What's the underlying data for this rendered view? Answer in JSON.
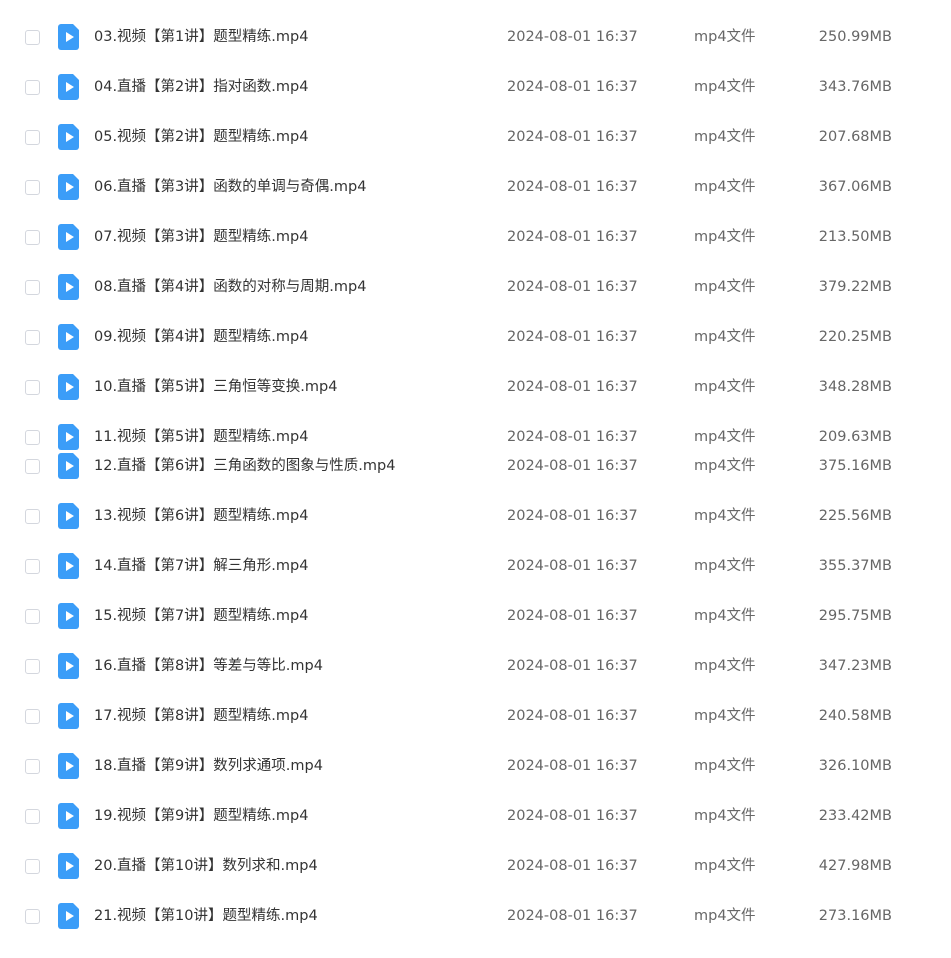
{
  "files": [
    {
      "name": "03.视频【第1讲】题型精练.mp4",
      "date": "2024-08-01 16:37",
      "type": "mp4文件",
      "size": "250.99MB"
    },
    {
      "name": "04.直播【第2讲】指对函数.mp4",
      "date": "2024-08-01 16:37",
      "type": "mp4文件",
      "size": "343.76MB"
    },
    {
      "name": "05.视频【第2讲】题型精练.mp4",
      "date": "2024-08-01 16:37",
      "type": "mp4文件",
      "size": "207.68MB"
    },
    {
      "name": "06.直播【第3讲】函数的单调与奇偶.mp4",
      "date": "2024-08-01 16:37",
      "type": "mp4文件",
      "size": "367.06MB"
    },
    {
      "name": "07.视频【第3讲】题型精练.mp4",
      "date": "2024-08-01 16:37",
      "type": "mp4文件",
      "size": "213.50MB"
    },
    {
      "name": "08.直播【第4讲】函数的对称与周期.mp4",
      "date": "2024-08-01 16:37",
      "type": "mp4文件",
      "size": "379.22MB"
    },
    {
      "name": "09.视频【第4讲】题型精练.mp4",
      "date": "2024-08-01 16:37",
      "type": "mp4文件",
      "size": "220.25MB"
    },
    {
      "name": "10.直播【第5讲】三角恒等变换.mp4",
      "date": "2024-08-01 16:37",
      "type": "mp4文件",
      "size": "348.28MB"
    },
    {
      "name": "11.视频【第5讲】题型精练.mp4",
      "date": "2024-08-01 16:37",
      "type": "mp4文件",
      "size": "209.63MB"
    },
    {
      "name": "12.直播【第6讲】三角函数的图象与性质.mp4",
      "date": "2024-08-01 16:37",
      "type": "mp4文件",
      "size": "375.16MB"
    },
    {
      "name": "13.视频【第6讲】题型精练.mp4",
      "date": "2024-08-01 16:37",
      "type": "mp4文件",
      "size": "225.56MB"
    },
    {
      "name": "14.直播【第7讲】解三角形.mp4",
      "date": "2024-08-01 16:37",
      "type": "mp4文件",
      "size": "355.37MB"
    },
    {
      "name": "15.视频【第7讲】题型精练.mp4",
      "date": "2024-08-01 16:37",
      "type": "mp4文件",
      "size": "295.75MB"
    },
    {
      "name": "16.直播【第8讲】等差与等比.mp4",
      "date": "2024-08-01 16:37",
      "type": "mp4文件",
      "size": "347.23MB"
    },
    {
      "name": "17.视频【第8讲】题型精练.mp4",
      "date": "2024-08-01 16:37",
      "type": "mp4文件",
      "size": "240.58MB"
    },
    {
      "name": "18.直播【第9讲】数列求通项.mp4",
      "date": "2024-08-01 16:37",
      "type": "mp4文件",
      "size": "326.10MB"
    },
    {
      "name": "19.视频【第9讲】题型精练.mp4",
      "date": "2024-08-01 16:37",
      "type": "mp4文件",
      "size": "233.42MB"
    },
    {
      "name": "20.直播【第10讲】数列求和.mp4",
      "date": "2024-08-01 16:37",
      "type": "mp4文件",
      "size": "427.98MB"
    },
    {
      "name": "21.视频【第10讲】题型精练.mp4",
      "date": "2024-08-01 16:37",
      "type": "mp4文件",
      "size": "273.16MB"
    }
  ],
  "icons": {
    "file": "video-file-icon",
    "checkbox": "checkbox-unchecked"
  },
  "colors": {
    "file_icon": "#3b9df8",
    "text_primary": "#333333",
    "text_secondary": "#666666"
  }
}
